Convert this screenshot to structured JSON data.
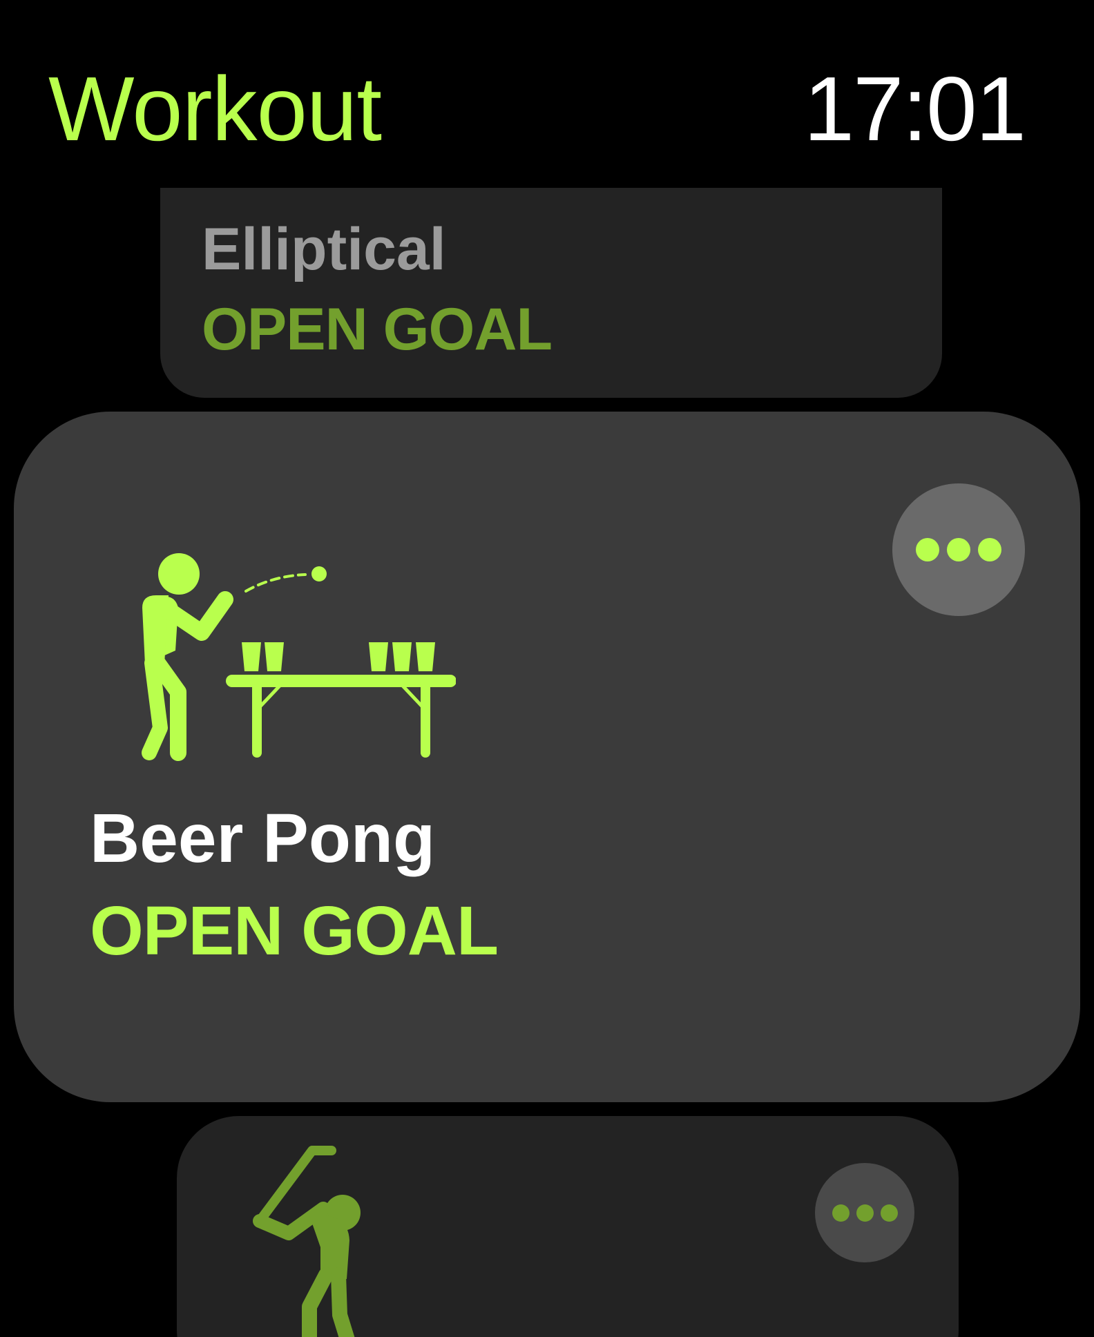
{
  "header": {
    "title": "Workout",
    "time": "17:01"
  },
  "workouts": [
    {
      "name": "Elliptical",
      "goal": "OPEN GOAL",
      "icon": "elliptical-icon"
    },
    {
      "name": "Beer Pong",
      "goal": "OPEN GOAL",
      "icon": "beer-pong-icon",
      "more_icon": "ellipsis-icon"
    },
    {
      "name": "",
      "goal": "",
      "icon": "golf-icon",
      "more_icon": "ellipsis-icon"
    }
  ],
  "colors": {
    "accent": "#b9ff4d",
    "accent_dim": "#73a02d",
    "card_focused": "#3b3b3b",
    "card_dim": "#232323",
    "background": "#000000"
  }
}
